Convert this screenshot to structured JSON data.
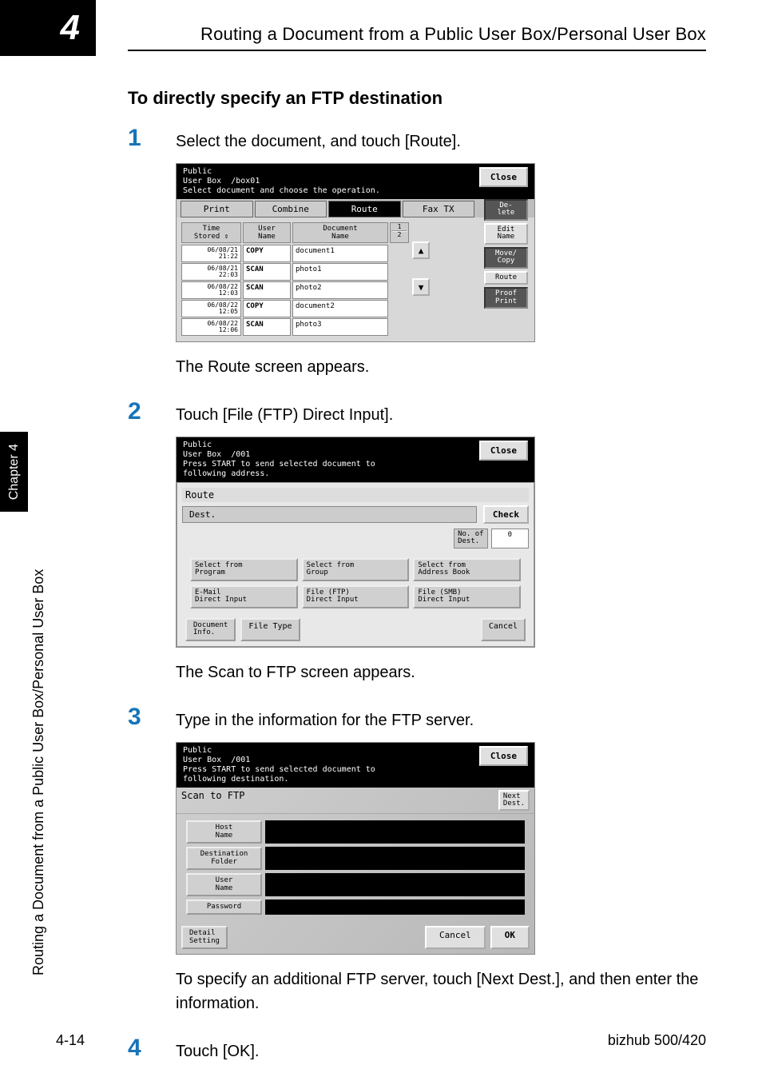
{
  "page_number": "4",
  "header_title": "Routing a Document from a Public User Box/Personal User Box",
  "side_tab_text": "Chapter 4",
  "side_text": "Routing a Document from a Public User Box/Personal User Box",
  "footer_left": "4-14",
  "footer_right": "bizhub 500/420",
  "section_heading": "To directly specify an FTP destination",
  "steps": [
    {
      "num": "1",
      "text": "Select the document, and touch [Route]."
    },
    {
      "num": "2",
      "text": "Touch [File (FTP) Direct Input]."
    },
    {
      "num": "3",
      "text": "Type in the information for the FTP server."
    },
    {
      "num": "4",
      "text": "Touch [OK]."
    }
  ],
  "followup1": "The Route screen appears.",
  "followup2": "The Scan to FTP screen appears.",
  "followup3": "To specify an additional FTP server, touch [Next Dest.], and then enter the information.",
  "ss1": {
    "header_line1": "Public\nUser Box",
    "box_label": "/box01",
    "instruction": "Select document and choose the operation.",
    "close": "Close",
    "tabs": {
      "print": "Print",
      "combine": "Combine",
      "route": "Route",
      "faxtx": "Fax TX"
    },
    "table": {
      "headers": {
        "time": "Time\nStored",
        "user": "User\nName",
        "doc": "Document\nName"
      },
      "pager_top": "1",
      "pager_bot": "2",
      "rows": [
        {
          "time": "06/08/21\n21:22",
          "user": "COPY",
          "doc": "document1"
        },
        {
          "time": "06/08/21\n22:03",
          "user": "SCAN",
          "doc": "photo1"
        },
        {
          "time": "06/08/22\n12:03",
          "user": "SCAN",
          "doc": "photo2"
        },
        {
          "time": "06/08/22\n12:05",
          "user": "COPY",
          "doc": "document2"
        },
        {
          "time": "06/08/22\n12:06",
          "user": "SCAN",
          "doc": "photo3"
        }
      ]
    },
    "side_buttons": {
      "delete": "De-\nlete",
      "editname": "Edit\nName",
      "movecopy": "Move/\nCopy",
      "route": "Route",
      "proof": "Proof\nPrint"
    }
  },
  "ss2": {
    "header_line1": "Public\nUser Box",
    "box_label": "/001",
    "instruction": "Press START to send selected document to\nfollowing address.",
    "close": "Close",
    "route_label": "Route",
    "dest_label": "Dest.",
    "check": "Check",
    "num_of_dest_label": "No. of\nDest.",
    "num_of_dest_val": "0",
    "buttons": {
      "program": "Select from\nProgram",
      "group": "Select from\nGroup",
      "addr": "Select from\nAddress Book",
      "email": "E-Mail\nDirect Input",
      "ftp": "File (FTP)\nDirect Input",
      "smb": "File (SMB)\nDirect Input"
    },
    "docinfo": "Document\nInfo.",
    "filetype": "File Type",
    "cancel": "Cancel"
  },
  "ss3": {
    "header_line1": "Public\nUser Box",
    "box_label": "/001",
    "instruction": "Press START to send selected document to\nfollowing destination.",
    "close": "Close",
    "title": "Scan to FTP",
    "next_dest": "Next\nDest.",
    "fields": {
      "host": "Host\nName",
      "folder": "Destination\nFolder",
      "user": "User\nName",
      "pass": "Password"
    },
    "detail": "Detail\nSetting",
    "cancel": "Cancel",
    "ok": "OK"
  }
}
